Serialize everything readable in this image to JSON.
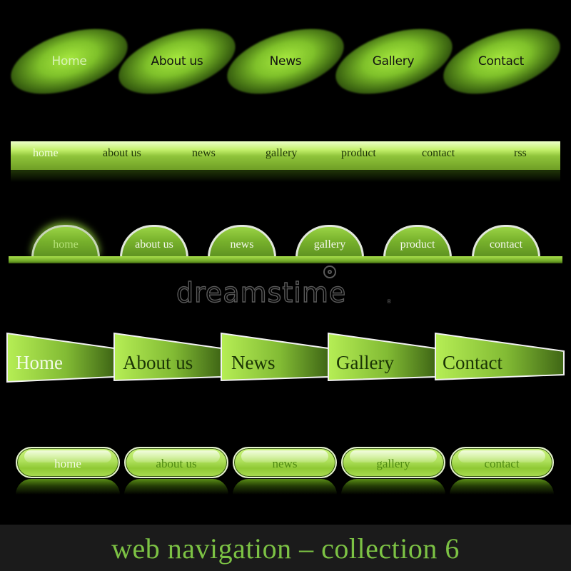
{
  "colors": {
    "background": "#000000",
    "accent_green": "#8fc43a",
    "bright_green": "#c2f06a",
    "footer_bg": "#1b1b1b",
    "footer_text": "#7cc244",
    "watermark": "#5a5a5a"
  },
  "nav_ellipse": {
    "active_index": 0,
    "items": [
      {
        "label": "Home"
      },
      {
        "label": "About us"
      },
      {
        "label": "News"
      },
      {
        "label": "Gallery"
      },
      {
        "label": "Contact"
      }
    ]
  },
  "nav_bar": {
    "active_index": 0,
    "items": [
      {
        "label": "home"
      },
      {
        "label": "about us"
      },
      {
        "label": "news"
      },
      {
        "label": "gallery"
      },
      {
        "label": "product"
      },
      {
        "label": "contact"
      },
      {
        "label": "rss"
      }
    ]
  },
  "nav_domes": {
    "active_index": 0,
    "items": [
      {
        "label": "home"
      },
      {
        "label": "about us"
      },
      {
        "label": "news"
      },
      {
        "label": "gallery"
      },
      {
        "label": "product"
      },
      {
        "label": "contact"
      }
    ]
  },
  "watermark": {
    "text": "dreamstime",
    "registered": "®"
  },
  "nav_trapezoid": {
    "active_index": 0,
    "items": [
      {
        "label": "Home"
      },
      {
        "label": "About us"
      },
      {
        "label": "News"
      },
      {
        "label": "Gallery"
      },
      {
        "label": "Contact"
      }
    ]
  },
  "nav_pills": {
    "active_index": 0,
    "items": [
      {
        "label": "home"
      },
      {
        "label": "about us"
      },
      {
        "label": "news"
      },
      {
        "label": "gallery"
      },
      {
        "label": "contact"
      }
    ]
  },
  "footer": {
    "title": "web navigation – collection 6"
  }
}
